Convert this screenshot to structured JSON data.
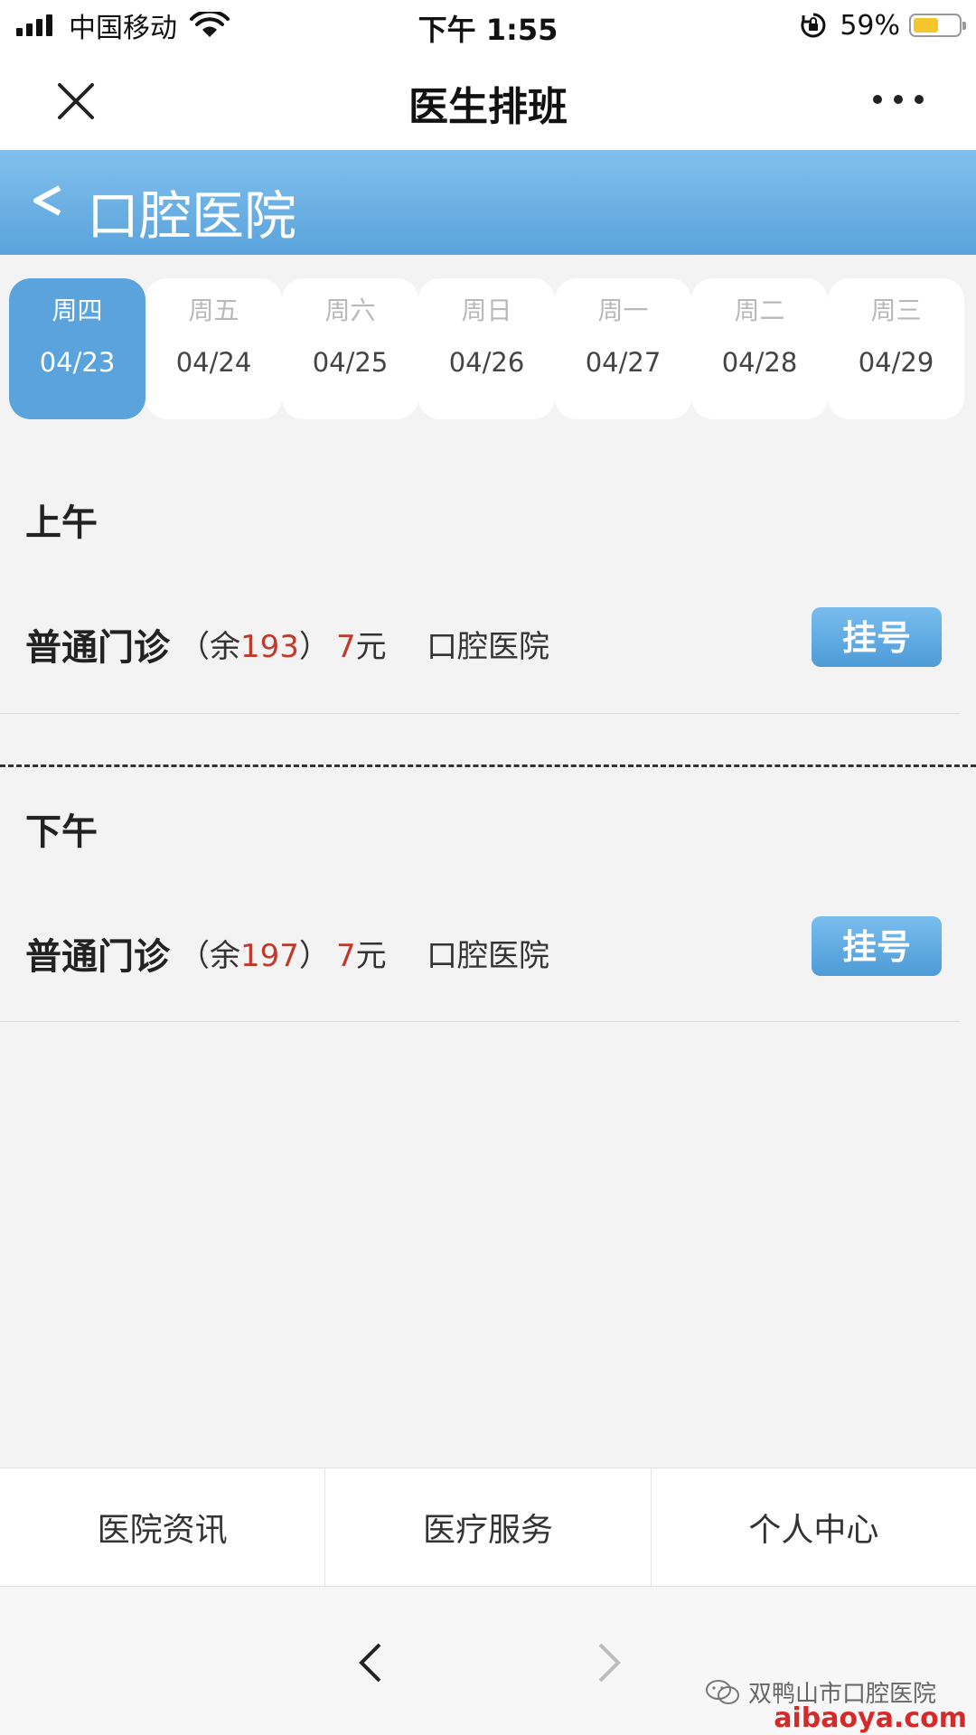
{
  "status_bar": {
    "carrier": "中国移动",
    "time": "下午 1:55",
    "battery_percent": "59%",
    "battery_level": 0.59
  },
  "nav": {
    "title": "医生排班",
    "close_icon": "close-icon",
    "more_icon": "more-icon"
  },
  "header": {
    "back_glyph": "<",
    "hospital_name": "口腔医院"
  },
  "dates": [
    {
      "dow": "周四",
      "date": "04/23",
      "active": true
    },
    {
      "dow": "周五",
      "date": "04/24",
      "active": false
    },
    {
      "dow": "周六",
      "date": "04/25",
      "active": false
    },
    {
      "dow": "周日",
      "date": "04/26",
      "active": false
    },
    {
      "dow": "周一",
      "date": "04/27",
      "active": false
    },
    {
      "dow": "周二",
      "date": "04/28",
      "active": false
    },
    {
      "dow": "周三",
      "date": "04/29",
      "active": false
    }
  ],
  "morning": {
    "title": "上午",
    "slot": {
      "type": "普通门诊",
      "remain_prefix": "（余",
      "remain": "193",
      "remain_suffix": "）",
      "price": "7",
      "price_unit": "元",
      "hospital": "口腔医院",
      "button": "挂号"
    }
  },
  "afternoon": {
    "title": "下午",
    "slot": {
      "type": "普通门诊",
      "remain_prefix": "（余",
      "remain": "197",
      "remain_suffix": "）",
      "price": "7",
      "price_unit": "元",
      "hospital": "口腔医院",
      "button": "挂号"
    }
  },
  "bottom_menu": [
    "医院资讯",
    "医疗服务",
    "个人中心"
  ],
  "watermark": {
    "account": "双鸭山市口腔医院",
    "site": "aibaoya.com"
  },
  "colors": {
    "accent": "#5aa3dc",
    "price_red": "#c0392b",
    "battery": "#f5c52c"
  }
}
